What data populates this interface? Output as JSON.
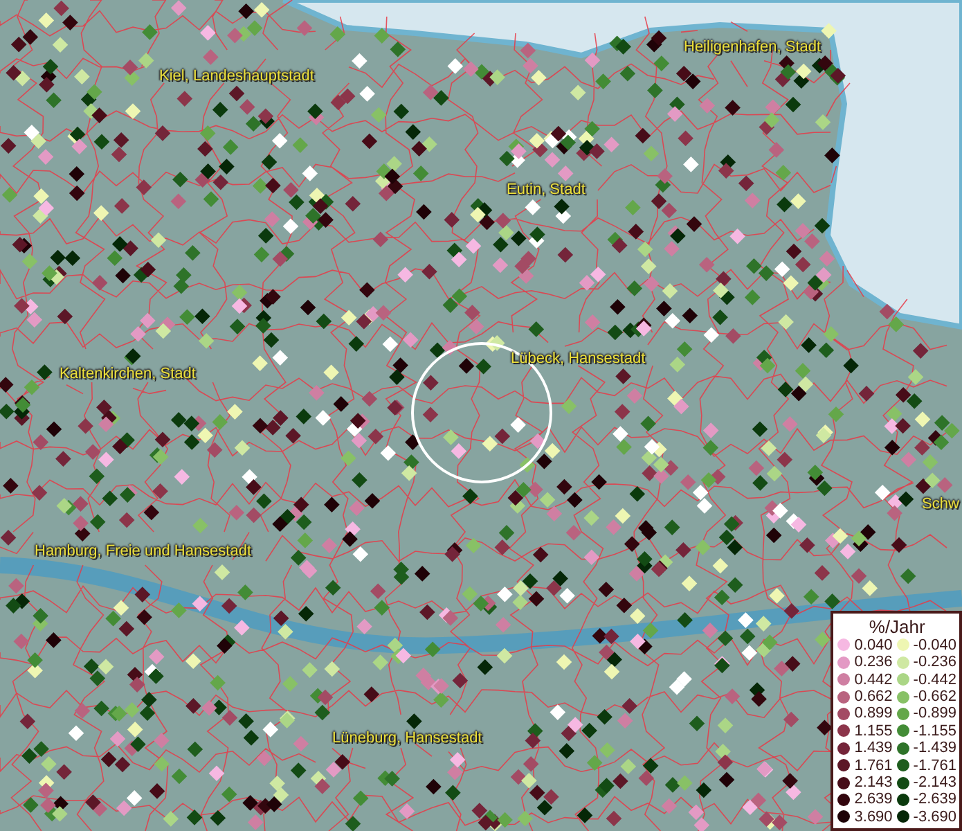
{
  "map": {
    "places": [
      {
        "name": "Kiel, Landeshauptstadt"
      },
      {
        "name": "Heiligenhafen, Stadt"
      },
      {
        "name": "Eutin, Stadt"
      },
      {
        "name": "Lübeck, Hansestadt"
      },
      {
        "name": "Kaltenkirchen, Stadt"
      },
      {
        "name": "Schw"
      },
      {
        "name": "Hamburg, Freie und Hansestadt"
      },
      {
        "name": "Lüneburg, Hansestadt"
      }
    ]
  },
  "legend": {
    "title": "%/Jahr",
    "columns": [
      {
        "items": [
          {
            "label": "0.040",
            "color": "#f6b8e2"
          },
          {
            "label": "0.236",
            "color": "#e39ac4"
          },
          {
            "label": "0.442",
            "color": "#cf7fa2"
          },
          {
            "label": "0.662",
            "color": "#b9637f"
          },
          {
            "label": "0.899",
            "color": "#a34b64"
          },
          {
            "label": "1.155",
            "color": "#8c354a"
          },
          {
            "label": "1.439",
            "color": "#74253a"
          },
          {
            "label": "1.761",
            "color": "#5c1727"
          },
          {
            "label": "2.143",
            "color": "#470c18"
          },
          {
            "label": "2.639",
            "color": "#33060e"
          },
          {
            "label": "3.690",
            "color": "#1f0207"
          }
        ]
      },
      {
        "items": [
          {
            "label": "-0.040",
            "color": "#eef6b2"
          },
          {
            "label": "-0.236",
            "color": "#cfe8a2"
          },
          {
            "label": "-0.442",
            "color": "#abd686"
          },
          {
            "label": "-0.662",
            "color": "#88c166"
          },
          {
            "label": "-0.899",
            "color": "#64a74a"
          },
          {
            "label": "-1.155",
            "color": "#438c36"
          },
          {
            "label": "-1.439",
            "color": "#2e7329"
          },
          {
            "label": "-1.761",
            "color": "#1e5d1d"
          },
          {
            "label": "-2.143",
            "color": "#134b14"
          },
          {
            "label": "-2.639",
            "color": "#0b3a0d"
          },
          {
            "label": "-3.690",
            "color": "#052707"
          }
        ]
      }
    ]
  }
}
